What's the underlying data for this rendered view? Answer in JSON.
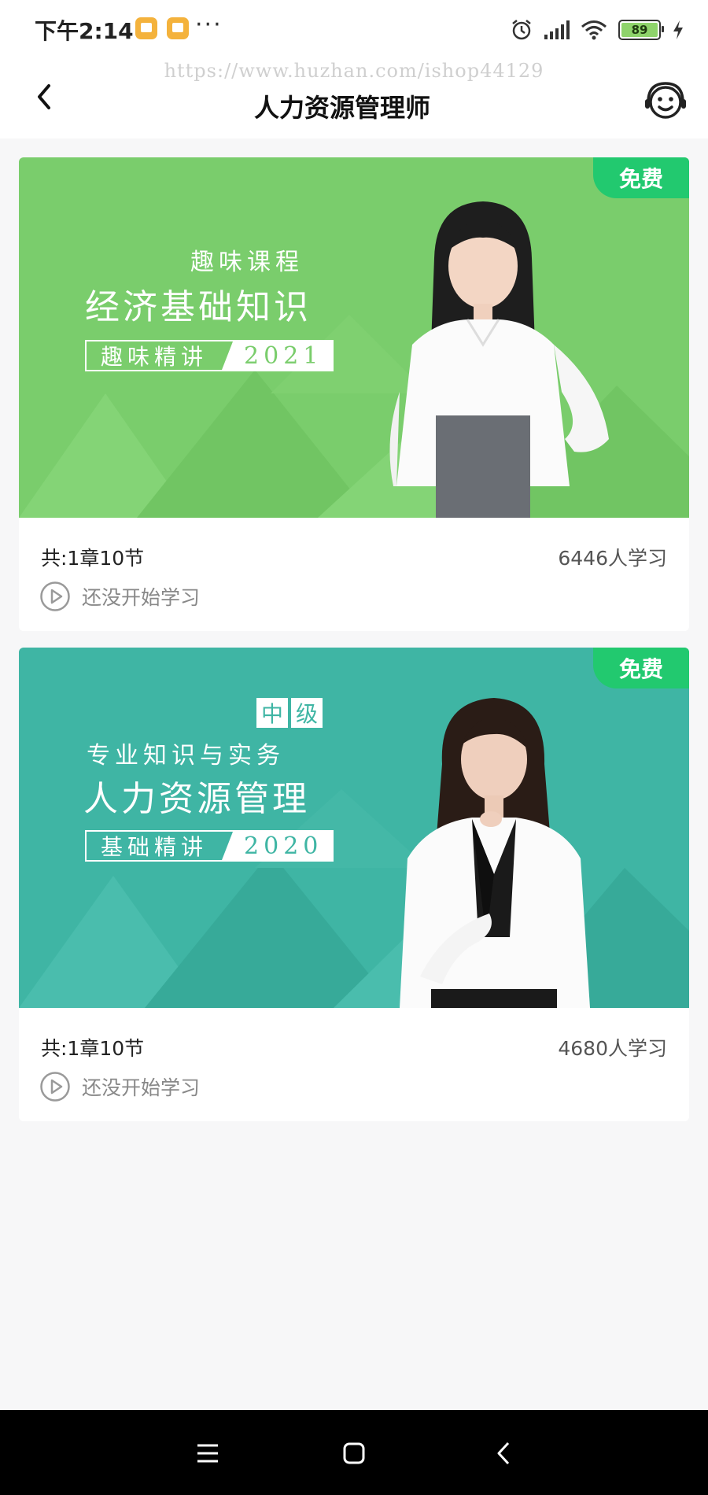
{
  "status_bar": {
    "time": "下午2:14",
    "more": "···",
    "battery": "89"
  },
  "header": {
    "watermark": "https://www.huzhan.com/ishop44129",
    "title": "人力资源管理师"
  },
  "courses": [
    {
      "badge": "免费",
      "banner": {
        "line1": "趣味课程",
        "line2": "经济基础知识",
        "tag_left": "趣味精讲",
        "tag_right": "2021"
      },
      "chapters": "共:1章10节",
      "learners": "6446人学习",
      "status": "还没开始学习",
      "banner_color": "#7acd6c"
    },
    {
      "badge": "免费",
      "banner": {
        "level_1": "中",
        "level_2": "级",
        "line1": "专业知识与实务",
        "line2": "人力资源管理",
        "tag_left": "基础精讲",
        "tag_right": "2020"
      },
      "chapters": "共:1章10节",
      "learners": "4680人学习",
      "status": "还没开始学习",
      "banner_color": "#3fb5a4"
    }
  ],
  "navigation": {
    "menu_icon": "menu-icon",
    "home_icon": "home-square-icon",
    "back_icon": "back-chevron-icon"
  },
  "colors": {
    "free_badge": "#22c96f",
    "green_banner": "#7acd6c",
    "teal_banner": "#3fb5a4"
  }
}
